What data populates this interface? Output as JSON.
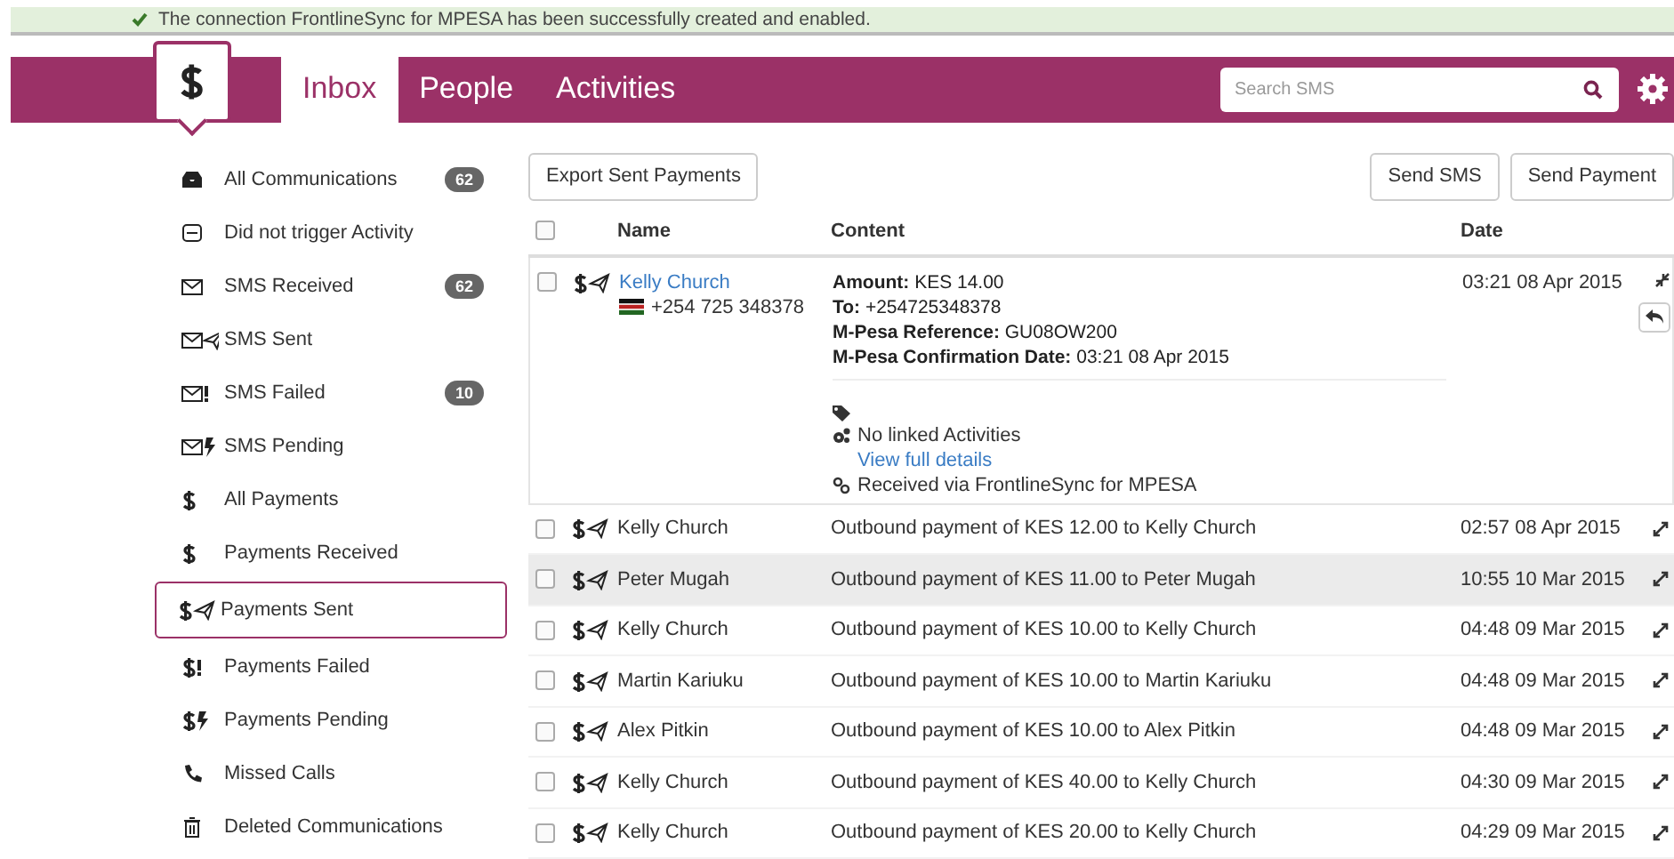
{
  "notice": {
    "text": "The connection FrontlineSync for MPESA has been successfully created and enabled."
  },
  "nav": {
    "tabs": [
      {
        "label": "Inbox",
        "selected": true
      },
      {
        "label": "People",
        "selected": false
      },
      {
        "label": "Activities",
        "selected": false
      }
    ],
    "search": {
      "placeholder": "Search SMS"
    }
  },
  "sidebar": {
    "items": [
      {
        "label": "All Communications",
        "kind": "inbox",
        "count": "62",
        "selected": false
      },
      {
        "label": "Did not trigger Activity",
        "kind": "minus",
        "selected": false
      },
      {
        "label": "SMS Received",
        "kind": "mail",
        "count": "62",
        "selected": false
      },
      {
        "label": "SMS Sent",
        "kind": "mail-sent",
        "selected": false
      },
      {
        "label": "SMS Failed",
        "kind": "mail-failed",
        "count": "10",
        "selected": false
      },
      {
        "label": "SMS Pending",
        "kind": "mail-pending",
        "selected": false
      },
      {
        "label": "All Payments",
        "kind": "dollar",
        "selected": false
      },
      {
        "label": "Payments Received",
        "kind": "dollar",
        "selected": false
      },
      {
        "label": "Payments Sent",
        "kind": "dollar-sent",
        "selected": true
      },
      {
        "label": "Payments Failed",
        "kind": "dollar-failed",
        "selected": false
      },
      {
        "label": "Payments Pending",
        "kind": "dollar-pending",
        "selected": false
      },
      {
        "label": "Missed Calls",
        "kind": "phone",
        "selected": false
      },
      {
        "label": "Deleted Communications",
        "kind": "trash",
        "selected": false
      }
    ]
  },
  "toolbar": {
    "left": [
      "Export Sent Payments"
    ],
    "right": [
      "Send SMS",
      "Send Payment"
    ]
  },
  "table": {
    "select_all": {
      "checked": false
    },
    "columns": [
      "Name",
      "Content",
      "Date"
    ],
    "expanded": {
      "name": "Kelly Church",
      "phone": "+254 725 348378",
      "checked": false,
      "fields": [
        {
          "label": "Amount:",
          "value": "KES 14.00"
        },
        {
          "label": "To:",
          "value": "+254725348378"
        },
        {
          "label": "M-Pesa Reference:",
          "value": "GU08OW200"
        },
        {
          "label": "M-Pesa Confirmation Date:",
          "value": "03:21 08 Apr 2015"
        }
      ],
      "activities": "No linked Activities",
      "details_link": "View full details",
      "source": "Received via FrontlineSync for MPESA",
      "date": "03:21 08 Apr 2015"
    },
    "rows": [
      {
        "name": "Kelly Church",
        "content": "Outbound payment of KES 12.00 to Kelly Church",
        "date": "02:57 08 Apr 2015",
        "checked": false,
        "highlighted": false
      },
      {
        "name": "Peter Mugah",
        "content": "Outbound payment of KES 11.00 to Peter Mugah",
        "date": "10:55 10 Mar 2015",
        "checked": false,
        "highlighted": true
      },
      {
        "name": "Kelly Church",
        "content": "Outbound payment of KES 10.00 to Kelly Church",
        "date": "04:48 09 Mar 2015",
        "checked": false,
        "highlighted": false
      },
      {
        "name": "Martin Kariuku",
        "content": "Outbound payment of KES 10.00 to Martin Kariuku",
        "date": "04:48 09 Mar 2015",
        "checked": false,
        "highlighted": false
      },
      {
        "name": "Alex Pitkin",
        "content": "Outbound payment of KES 10.00 to Alex Pitkin",
        "date": "04:48 09 Mar 2015",
        "checked": false,
        "highlighted": false
      },
      {
        "name": "Kelly Church",
        "content": "Outbound payment of KES 40.00 to Kelly Church",
        "date": "04:30 09 Mar 2015",
        "checked": false,
        "highlighted": false
      },
      {
        "name": "Kelly Church",
        "content": "Outbound payment of KES 20.00 to Kelly Church",
        "date": "04:29 09 Mar 2015",
        "checked": false,
        "highlighted": false
      }
    ]
  }
}
